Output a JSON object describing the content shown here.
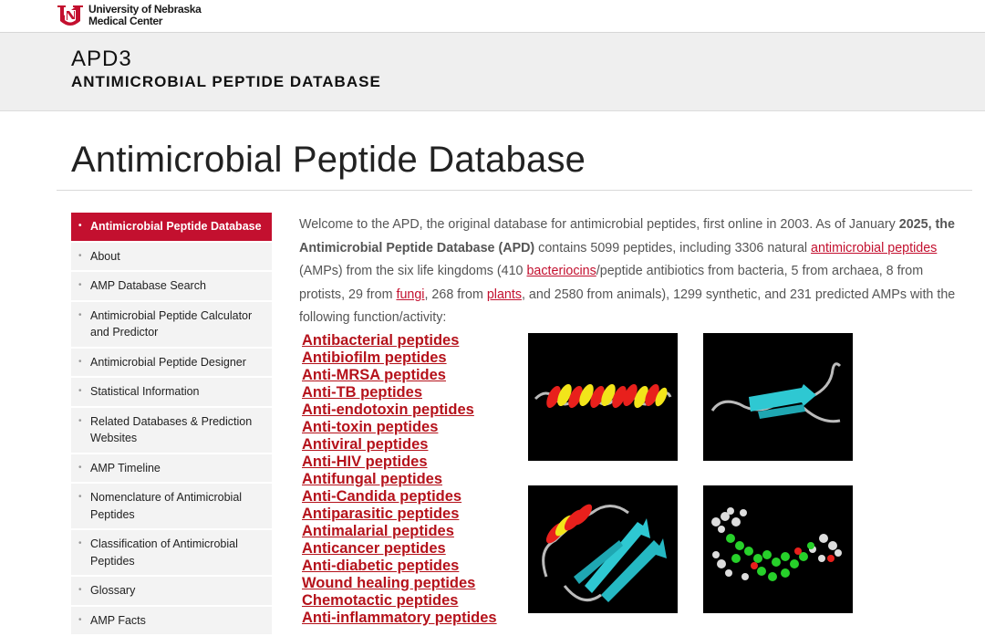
{
  "university": {
    "name_line1": "University of Nebraska",
    "name_line2": "Medical Center",
    "logo_icon": "unl-n-logo-icon",
    "brand_color": "#c3102f"
  },
  "site": {
    "name": "APD3",
    "subtitle": "ANTIMICROBIAL PEPTIDE DATABASE"
  },
  "page_title": "Antimicrobial Peptide Database",
  "sidebar": {
    "items": [
      {
        "label": "Antimicrobial Peptide Database",
        "active": true
      },
      {
        "label": "About"
      },
      {
        "label": "AMP Database Search"
      },
      {
        "label": "Antimicrobial Peptide Calculator and Predictor"
      },
      {
        "label": "Antimicrobial Peptide Designer"
      },
      {
        "label": "Statistical Information"
      },
      {
        "label": "Related Databases & Prediction Websites"
      },
      {
        "label": "AMP Timeline"
      },
      {
        "label": "Nomenclature of Antimicrobial Peptides"
      },
      {
        "label": "Classification of Antimicrobial Peptides"
      },
      {
        "label": "Glossary"
      },
      {
        "label": "AMP Facts"
      }
    ]
  },
  "intro": {
    "t1": "Welcome to the APD, the original database for antimicrobial peptides, first online in 2003. As of January ",
    "b1": "2025",
    "b2": ", the Antimicrobial Peptide Database (APD)",
    "t2": " contains 5099 peptides, including 3306 natural ",
    "l1": "antimicrobial peptides",
    "t3": " (AMPs) from the six life kingdoms (410 ",
    "l2": "bacteriocins",
    "t4": "/peptide antibiotics from bacteria, 5 from archaea, 8 from protists, 29 from ",
    "l3": "fungi",
    "t5": ", 268 from ",
    "l4": "plants",
    "t6": ", and 2580 from animals), 1299 synthetic, and 231 predicted AMPs with the following function/activity:"
  },
  "functions": [
    "Antibacterial peptides",
    "Antibiofilm peptides",
    "Anti-MRSA peptides",
    "Anti-TB peptides",
    "Anti-endotoxin peptides",
    "Anti-toxin peptides",
    "Antiviral peptides",
    "Anti-HIV peptides",
    "Antifungal peptides",
    "Anti-Candida peptides",
    "Antiparasitic peptides",
    "Antimalarial peptides",
    "Anticancer peptides",
    "Anti-diabetic peptides",
    "Wound healing peptides",
    "Chemotactic peptides",
    "Anti-inflammatory peptides"
  ],
  "structures": [
    {
      "icon": "alpha-helix-structure-image"
    },
    {
      "icon": "beta-hairpin-structure-image"
    },
    {
      "icon": "alpha-beta-structure-image"
    },
    {
      "icon": "ball-and-stick-molecule-image"
    }
  ]
}
